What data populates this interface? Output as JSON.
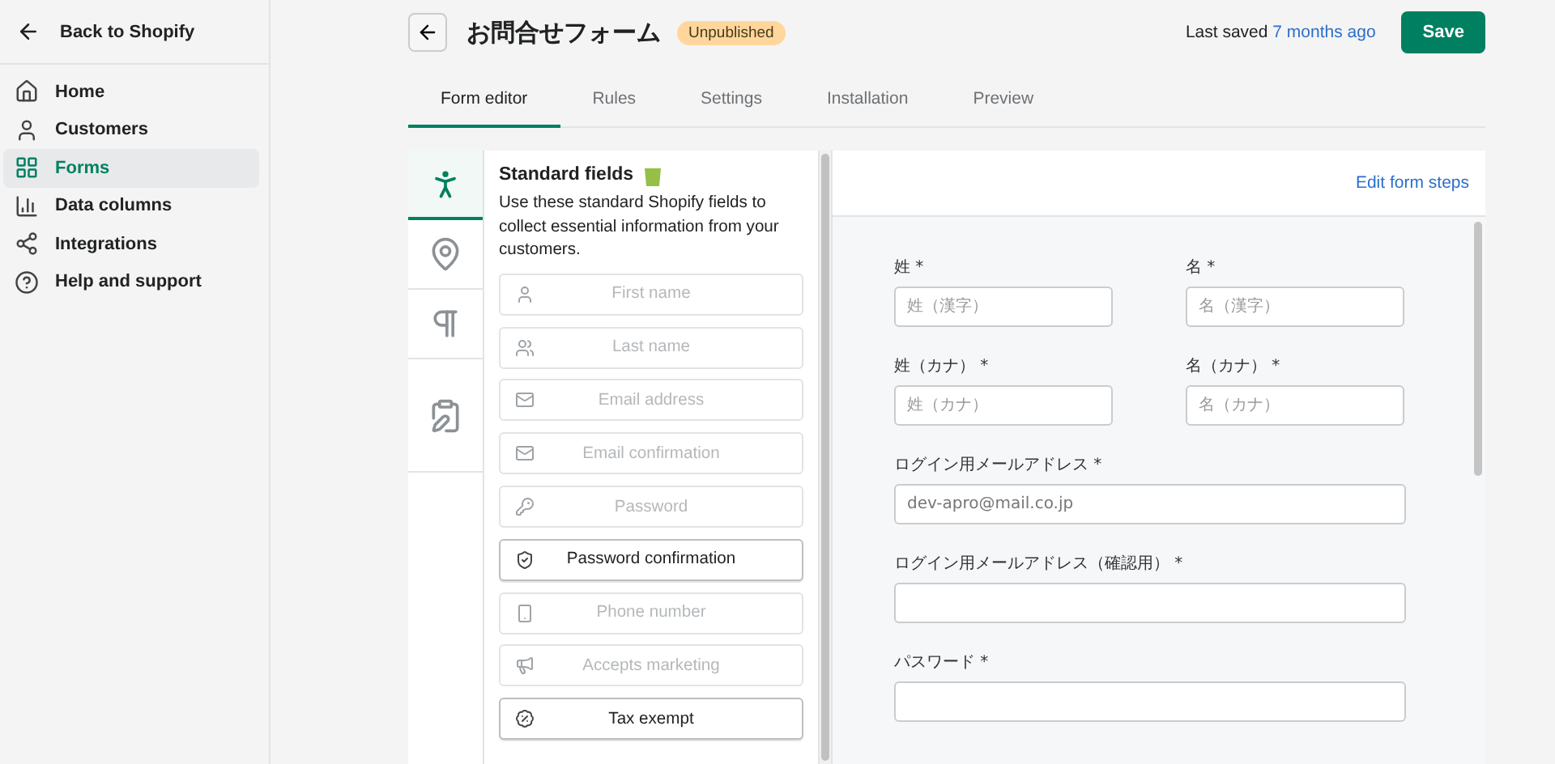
{
  "sidebar": {
    "back": "Back to Shopify",
    "items": [
      {
        "label": "Home",
        "selected": false
      },
      {
        "label": "Customers",
        "selected": false
      },
      {
        "label": "Forms",
        "selected": true
      },
      {
        "label": "Data columns",
        "selected": false
      },
      {
        "label": "Integrations",
        "selected": false
      },
      {
        "label": "Help and support",
        "selected": false
      }
    ]
  },
  "header": {
    "title": "お問合せフォーム",
    "badge": "Unpublished",
    "saved_label": "Last saved",
    "saved_link": "7 months ago",
    "save": "Save"
  },
  "tabs": [
    {
      "label": "Form editor",
      "selected": true
    },
    {
      "label": "Rules",
      "selected": false
    },
    {
      "label": "Settings",
      "selected": false
    },
    {
      "label": "Installation",
      "selected": false
    },
    {
      "label": "Preview",
      "selected": false
    }
  ],
  "element_tabs": [
    {
      "selected": true
    },
    {
      "selected": false
    },
    {
      "selected": false
    },
    {
      "selected": false
    }
  ],
  "standard_fields": {
    "title": "Standard fields",
    "description": "Use these standard Shopify fields to collect essential information from your customers.",
    "items": [
      {
        "label": "First name",
        "disabled": true
      },
      {
        "label": "Last name",
        "disabled": true
      },
      {
        "label": "Email address",
        "disabled": true
      },
      {
        "label": "Email confirmation",
        "disabled": true
      },
      {
        "label": "Password",
        "disabled": true
      },
      {
        "label": "Password confirmation",
        "disabled": false
      },
      {
        "label": "Phone number",
        "disabled": true
      },
      {
        "label": "Accepts marketing",
        "disabled": true
      },
      {
        "label": "Tax exempt",
        "disabled": false
      }
    ]
  },
  "preview": {
    "edit_steps": "Edit form steps",
    "fields": [
      {
        "label": "姓 *",
        "placeholder": "姓（漢字）",
        "kind": "half"
      },
      {
        "label": "名 *",
        "placeholder": "名（漢字）",
        "kind": "half"
      },
      {
        "label": "姓（カナ） *",
        "placeholder": "姓（カナ）",
        "kind": "half"
      },
      {
        "label": "名（カナ） *",
        "placeholder": "名（カナ）",
        "kind": "half"
      },
      {
        "label": "ログイン用メールアドレス *",
        "value": "dev-apro@mail.co.jp",
        "kind": "full"
      },
      {
        "label": "ログイン用メールアドレス（確認用） *",
        "kind": "full"
      },
      {
        "label": "パスワード *",
        "kind": "full"
      }
    ]
  }
}
